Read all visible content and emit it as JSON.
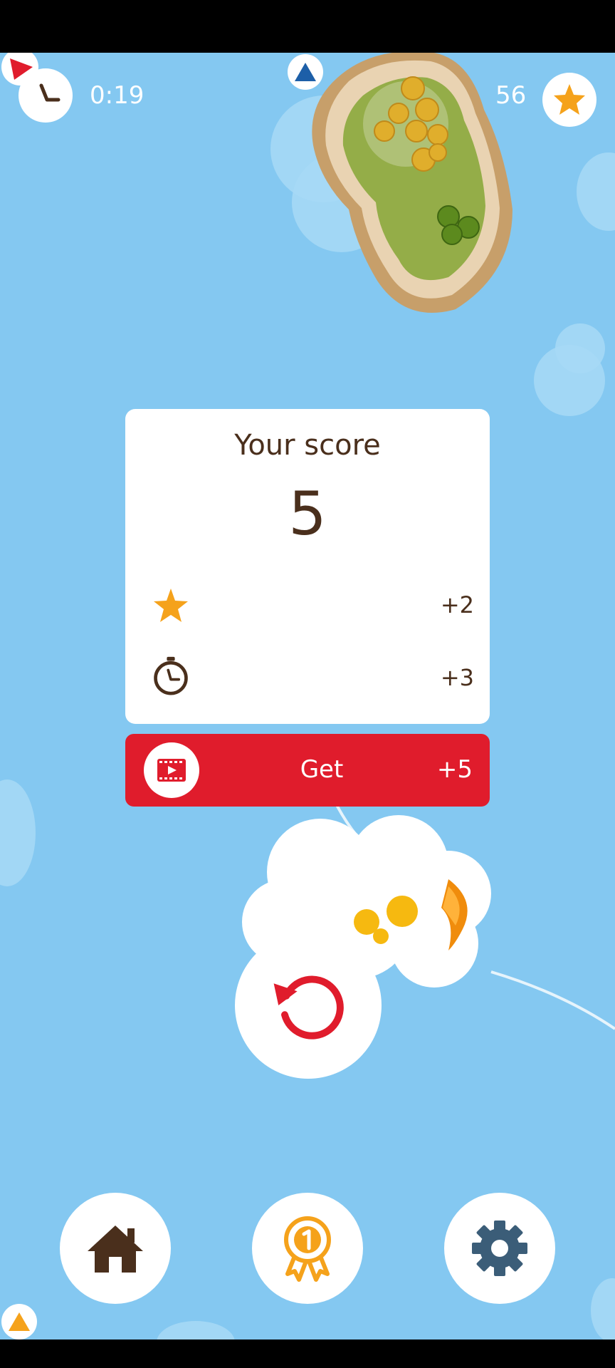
{
  "hud": {
    "timer": "0:19",
    "stars_total": "56",
    "timer_icon": "clock-icon",
    "stars_icon": "star-icon"
  },
  "score_card": {
    "title": "Your score",
    "score": "5",
    "rows": [
      {
        "icon": "star-icon",
        "value": "+2"
      },
      {
        "icon": "stopwatch-icon",
        "value": "+3"
      }
    ]
  },
  "reward_button": {
    "icon": "video-ad-icon",
    "label": "Get",
    "bonus": "+5"
  },
  "controls": {
    "replay_icon": "replay-icon",
    "home_icon": "home-icon",
    "achievements_icon": "medal-icon",
    "settings_icon": "gear-icon"
  },
  "colors": {
    "sky": "#84c8f1",
    "accent_red": "#e01c2c",
    "star_orange": "#f5a21b",
    "text_brown": "#4a2f1c",
    "settings_blue": "#3b5d78"
  }
}
